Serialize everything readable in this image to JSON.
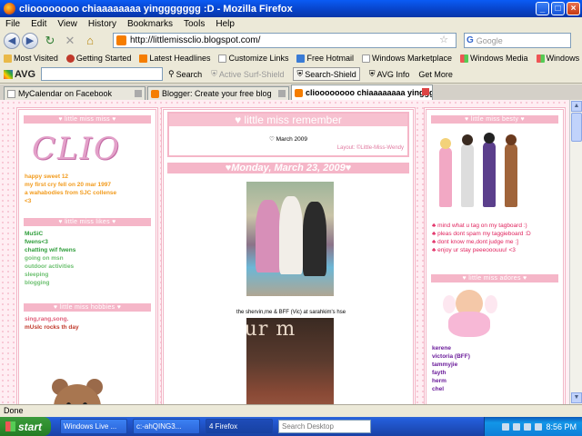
{
  "window": {
    "title": "clioooooooo chiaaaaaaaa yinggggggg :D - Mozilla Firefox"
  },
  "menu": [
    "File",
    "Edit",
    "View",
    "History",
    "Bookmarks",
    "Tools",
    "Help"
  ],
  "nav": {
    "url": "http://littlemissclio.blogspot.com/",
    "search_placeholder": "Google"
  },
  "bookmarks": [
    "Most Visited",
    "Getting Started",
    "Latest Headlines",
    "Customize Links",
    "Free Hotmail",
    "Windows Marketplace",
    "Windows Media",
    "Windows"
  ],
  "avg": {
    "logo": "AVG",
    "search": "Search",
    "active_surf": "Active Surf-Shield",
    "search_shield": "Search-Shield",
    "info": "AVG Info",
    "get_more": "Get More"
  },
  "tabs": [
    {
      "label": "MyCalendar on Facebook"
    },
    {
      "label": "Blogger: Create your free blog"
    },
    {
      "label": "clioooooooo chiaaaaaaaa yinggg..."
    }
  ],
  "blog": {
    "left": {
      "head1": "♥ little miss miss ♥",
      "logo": "CLIO",
      "intro": [
        "happy sweet 12",
        "my first cry fell on 20 mar 1997",
        "a wahabodies from SJC collense",
        "<3"
      ],
      "head2": "♥ little miss likes ♥",
      "likes": [
        "MuSiC",
        "fwens<3",
        "chatting wif fwens",
        "going on msn",
        "outdoor activities",
        "sleeping",
        "blogging"
      ],
      "head3": "♥ little miss hobbies ♥",
      "hobbies": [
        "sing,rang,song.",
        "mUsIc rocks th day"
      ]
    },
    "main": {
      "title": "♥ little miss remember",
      "month": "♡ March 2009",
      "layout_credit": "Layout: ©Little-Miss-Wendy",
      "post_date": "♥Monday, March 23, 2009♥",
      "caption": "the shervin,me & BFF (Vic) at sarahkim's hse",
      "photo2_text": "your m"
    },
    "right": {
      "head1": "♥ little miss besty ♥",
      "rules": [
        "mind what u tag on my tagboard :)",
        "pleas dont spam my taggieboard :D",
        "dont know me,dont judge me :]",
        "enjoy ur stay peeeooouuu! <3"
      ],
      "head2": "♥ little miss adores ♥",
      "friends": [
        "kerene",
        "victoria (BFF)",
        "tammyjie",
        "fayth",
        "herm",
        "chel"
      ]
    }
  },
  "status": "Done",
  "taskbar": {
    "start": "start",
    "tasks": [
      "Windows Live ...",
      "c:-ahQING3...",
      "4 Firefox"
    ],
    "search_placeholder": "Search Desktop",
    "clock": "8:56 PM"
  },
  "colors": {
    "pink_header": "#f5b6c8",
    "link_orange": "#f29b1d",
    "link_green": "#4caf50",
    "rule_red": "#e0245e",
    "friend_purple": "#6a1b9a"
  }
}
